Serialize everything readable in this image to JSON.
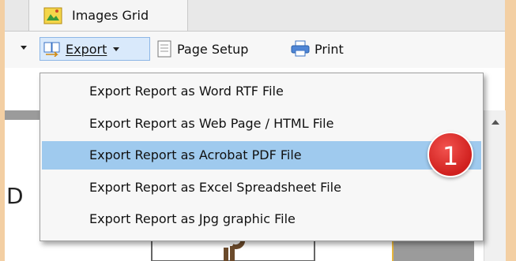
{
  "tab": {
    "label": "Images Grid"
  },
  "toolbar": {
    "export_label": "Export",
    "page_setup_label": "Page Setup",
    "print_label": "Print"
  },
  "menu": {
    "items": [
      {
        "label": "Export Report as Word RTF File"
      },
      {
        "label": "Export Report as Web Page / HTML File"
      },
      {
        "label": "Export Report as Acrobat PDF File",
        "selected": true
      },
      {
        "label": "Export Report as Excel Spreadsheet File"
      },
      {
        "label": "Export Report as Jpg graphic File"
      }
    ]
  },
  "badge": {
    "number": "1",
    "color": "#e03a36"
  },
  "document": {
    "page_text": "D"
  },
  "colors": {
    "background": "#f3cfa3",
    "selection": "#9fcaee",
    "accent": "#e7b53b"
  }
}
